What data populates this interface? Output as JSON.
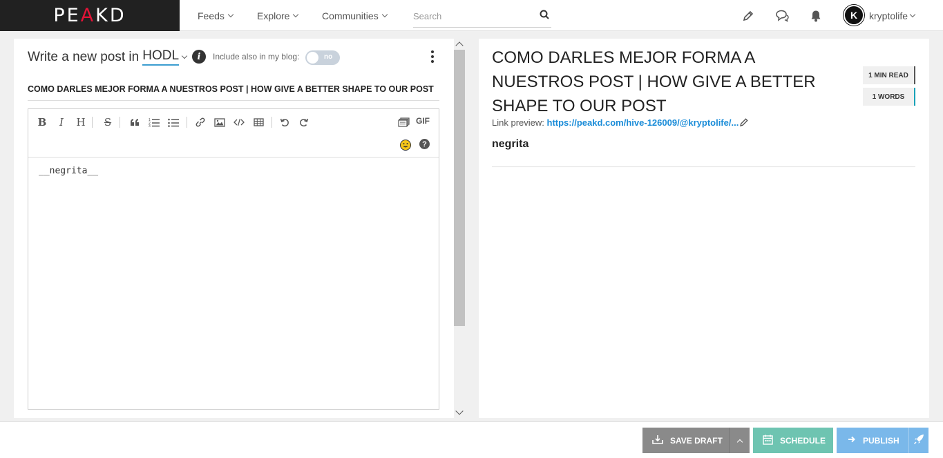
{
  "header": {
    "logo_main": "PE",
    "logo_accent": "A",
    "logo_tail": "KD",
    "nav": [
      {
        "label": "Feeds"
      },
      {
        "label": "Explore"
      },
      {
        "label": "Communities"
      }
    ],
    "search_placeholder": "Search",
    "avatar_letter": "K",
    "username": "kryptolife"
  },
  "editor": {
    "write_prefix": "Write a new post in",
    "community": "HODL",
    "include_blog_label": "Include also in my blog:",
    "toggle_state": "no",
    "title_value": "COMO DARLES MEJOR FORMA A NUESTROS POST  | HOW GIVE A BETTER SHAPE TO OUR POST",
    "toolbar": {
      "bold": "B",
      "italic": "I",
      "heading": "H",
      "strike": "S",
      "gif": "GIF",
      "help": "?"
    },
    "body": "__negrita__"
  },
  "preview": {
    "title": "COMO DARLES MEJOR FORMA A NUESTROS POST | HOW GIVE A BETTER SHAPE TO OUR POST",
    "read_time": "1 MIN READ",
    "word_count": "1 WORDS",
    "link_label": "Link preview:",
    "link_url": "https://peakd.com/hive-126009/@kryptolife/...",
    "body": "negrita"
  },
  "footer": {
    "save_draft": "SAVE DRAFT",
    "schedule": "SCHEDULE",
    "publish": "PUBLISH"
  },
  "colors": {
    "brand_red": "#e31337",
    "link_blue": "#1a8cd8",
    "schedule_green": "#6ec4b1",
    "publish_blue": "#7ab8ea",
    "draft_gray": "#8a8a8a"
  }
}
